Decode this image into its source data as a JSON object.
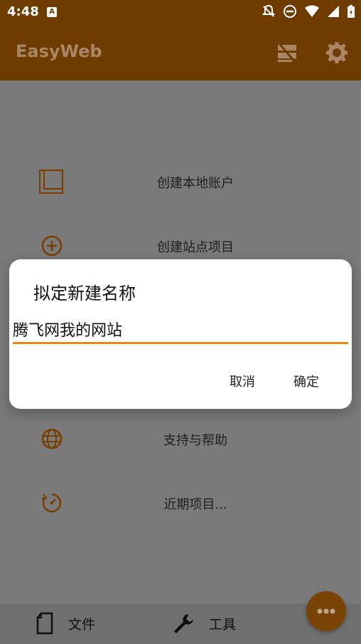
{
  "status_bar": {
    "time": "4:48",
    "notification_icon": "A"
  },
  "app_bar": {
    "title": "EasyWeb",
    "icons": [
      "server-off-icon",
      "gear-icon"
    ]
  },
  "menu": {
    "items": [
      {
        "label": "创建本地账户",
        "icon": "square-outline-icon"
      },
      {
        "label": "创建站点项目",
        "icon": "plus-circle-icon"
      },
      {
        "label": "支持与帮助",
        "icon": "globe-icon"
      },
      {
        "label": "近期项目...",
        "icon": "clock-refresh-icon"
      }
    ]
  },
  "dialog": {
    "title": "拟定新建名称",
    "input_value": "腾飞网我的网站",
    "cancel_label": "取消",
    "confirm_label": "确定"
  },
  "bottom_bar": {
    "file_label": "文件",
    "tools_label": "工具"
  },
  "colors": {
    "brand": "#6e3c00",
    "accent": "#e8890b",
    "icon_orange": "#7a3d00"
  }
}
